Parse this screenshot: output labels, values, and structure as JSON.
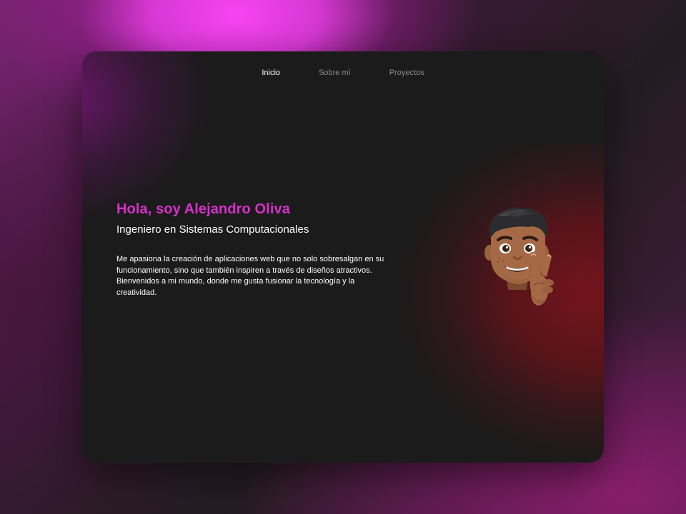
{
  "nav": {
    "items": [
      {
        "label": "Inicio",
        "active": true
      },
      {
        "label": "Sobre mí",
        "active": false
      },
      {
        "label": "Proyectos",
        "active": false
      }
    ]
  },
  "hero": {
    "greeting": "Hola, soy Alejandro Oliva",
    "subtitle": "Ingeniero en Sistemas Computacionales",
    "description": "Me apasiona la creación de aplicaciones web que no solo sobresalgan en su funcionamiento, sino que también inspiren a través de diseños atractivos. Bienvenidos a mi mundo, donde me gusta fusionar la tecnología y la creatividad."
  },
  "avatar": {
    "icon": "memoji-peace-sign-icon"
  },
  "colors": {
    "accent": "#d630c9",
    "window_bg": "#1b1b1b",
    "nav_inactive": "#8c8c8c",
    "text": "#ffffff"
  }
}
